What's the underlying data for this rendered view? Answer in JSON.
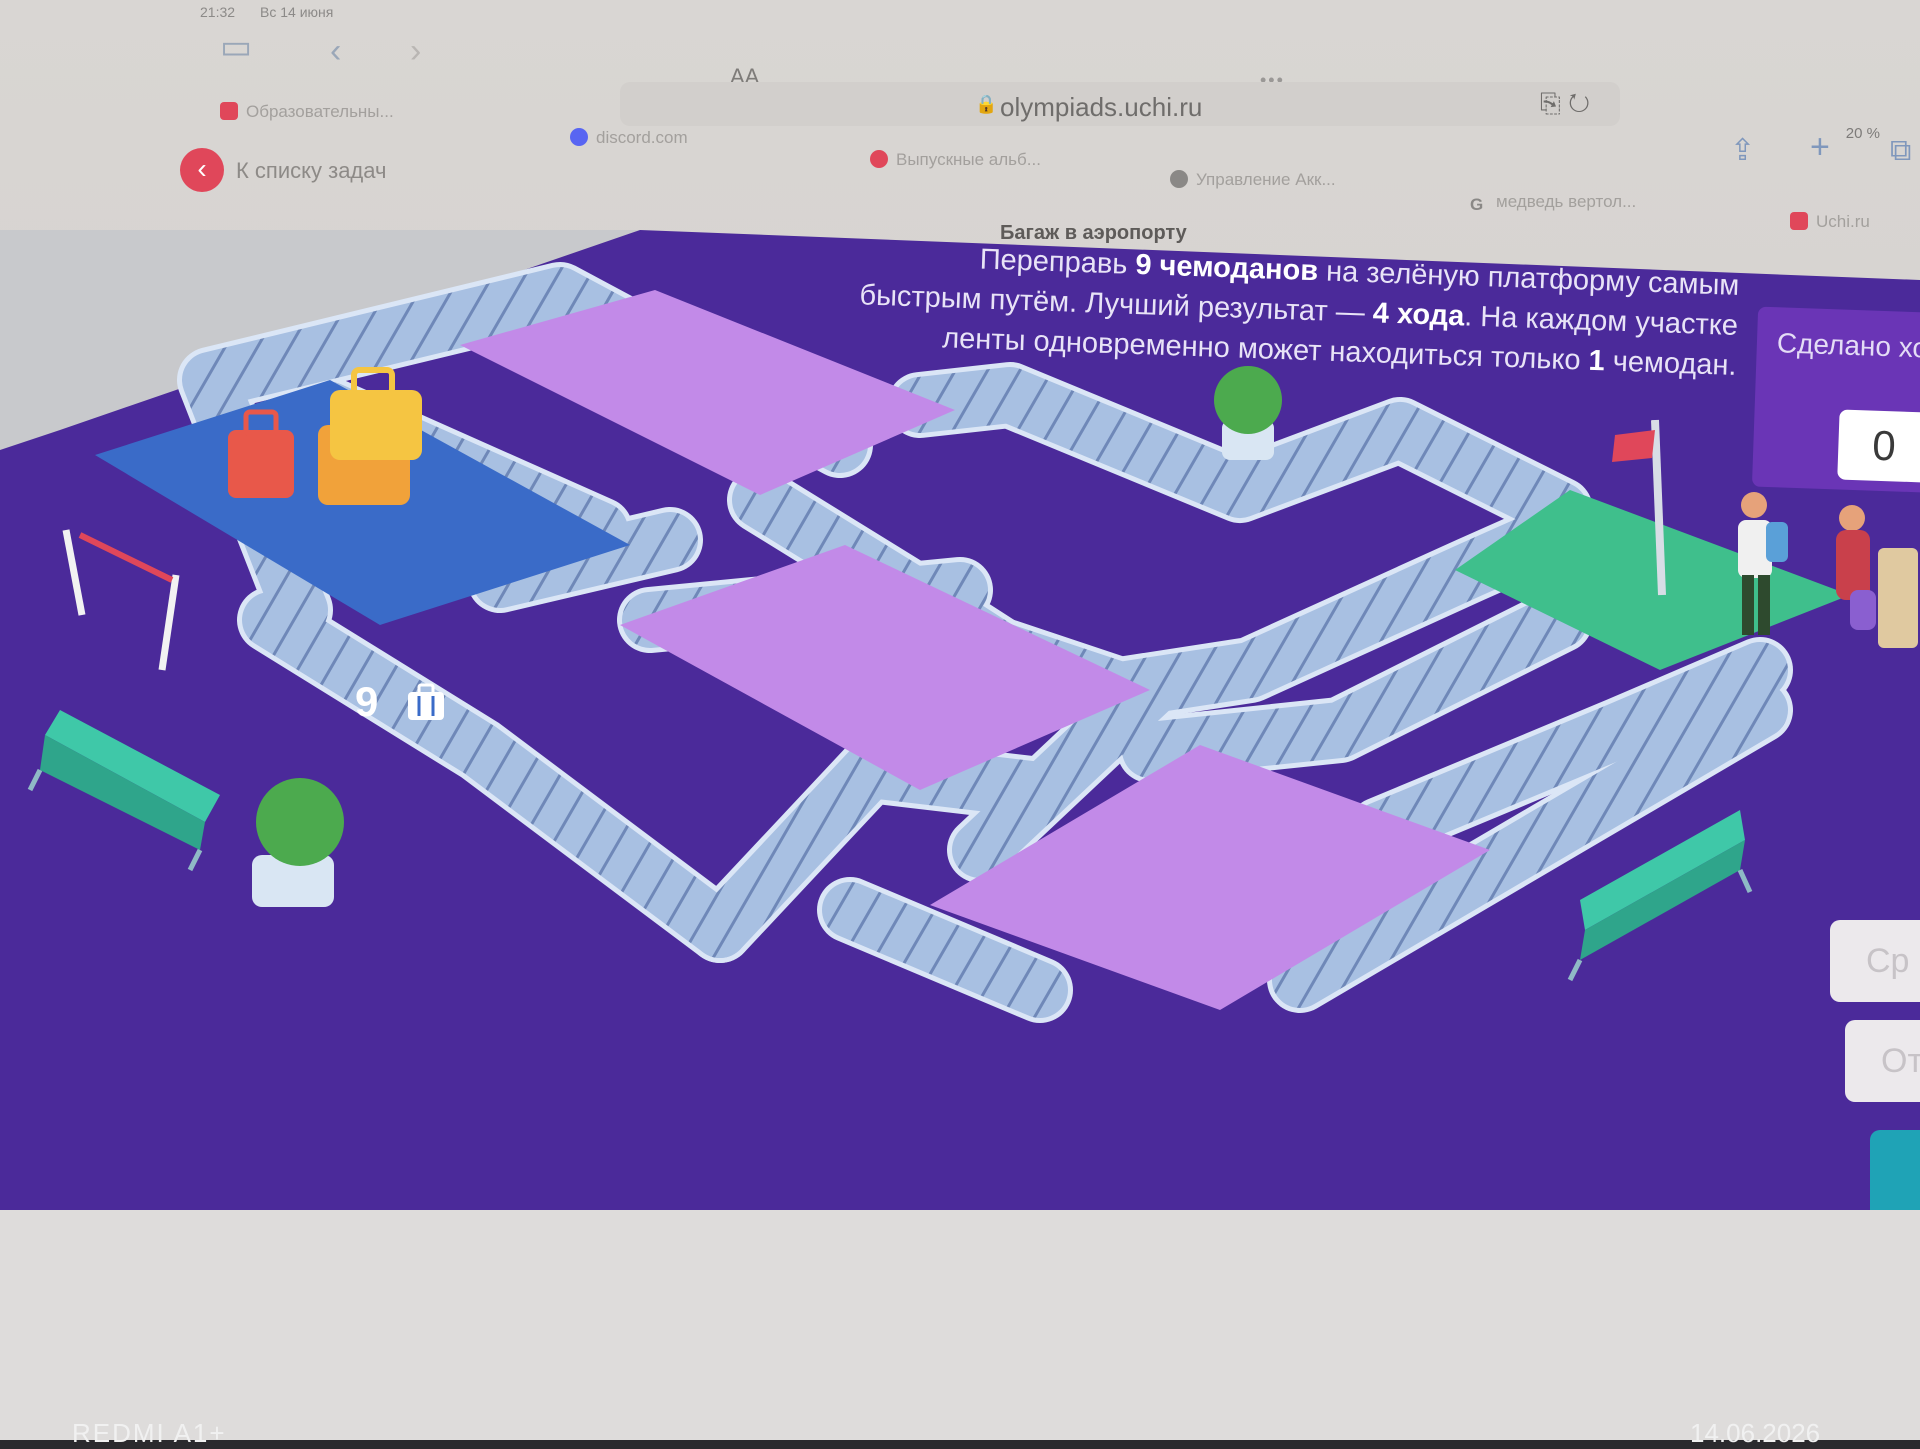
{
  "status": {
    "time": "21:32",
    "date": "Вс 14 июня",
    "battery": "20 %"
  },
  "browser": {
    "text_size_button": "AA",
    "url": "olympiads.uchi.ru",
    "tabs": [
      {
        "label": "Образовательны...",
        "color": "#e0475a"
      },
      {
        "label": "discord.com",
        "color": "#5865f2"
      },
      {
        "label": "Выпускные альб...",
        "color": "#e0475a"
      },
      {
        "label": "Управление Акк...",
        "color": "#8a8886"
      },
      {
        "label": "медведь вертол...",
        "color": "#8a8886"
      },
      {
        "label": "Uchi.ru",
        "color": "#e0475a"
      }
    ],
    "back_to_list": "К списку задач",
    "page_title": "Багаж в аэропорту"
  },
  "task": {
    "line1_pre": "Переправь ",
    "line1_bold": "9 чемоданов",
    "line1_post": " на зелёную платформу самым",
    "line2_pre": "быстрым путём. Лучший результат — ",
    "line2_bold": "4 хода",
    "line2_post": ". На каждом участке",
    "line3_pre": "ленты одновременно может находиться только ",
    "line3_bold": "1",
    "line3_post": " чемодан."
  },
  "moves": {
    "label": "Сделано хо",
    "value": "0"
  },
  "buttons": {
    "side_top": "Ср",
    "side_mid": "От"
  },
  "luggage": {
    "count": "9"
  },
  "colors": {
    "floor": "#4b2a9a",
    "belt": "#a8c0e2",
    "platform_purple": "#c28ae8",
    "platform_green": "#3fbf8c",
    "platform_start": "#3a6bc8"
  },
  "watermark": {
    "left": "REDMI A1+",
    "right": "14.06.2026"
  }
}
